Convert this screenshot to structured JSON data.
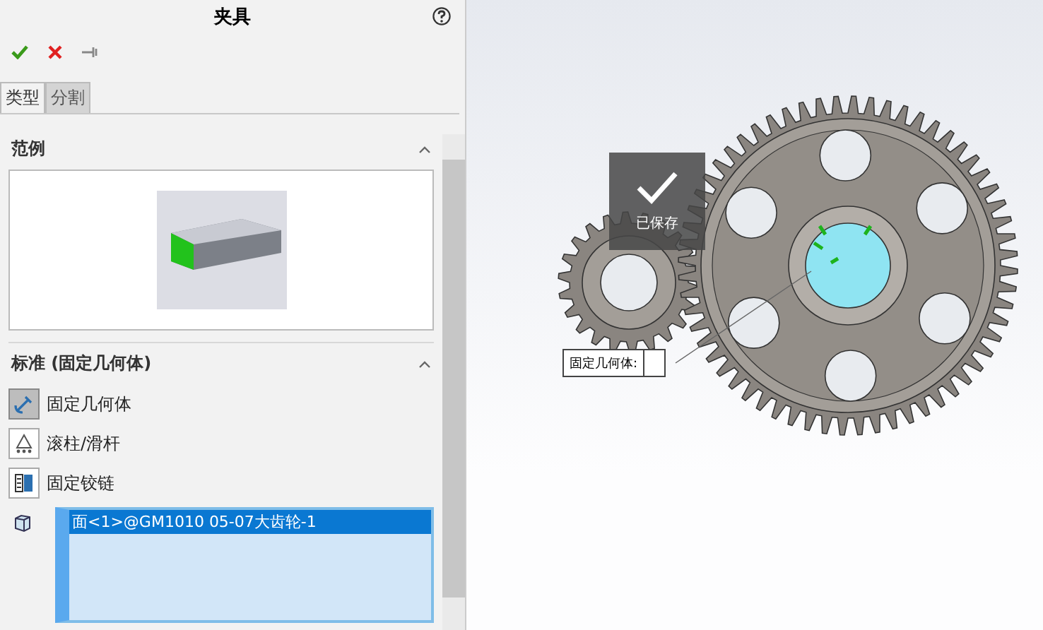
{
  "panel": {
    "title": "夹具",
    "tabs": [
      {
        "label": "类型",
        "selected": true
      },
      {
        "label": "分割",
        "selected": false
      }
    ],
    "example_section": {
      "title": "范例"
    },
    "standard_section": {
      "title": "标准 (固定几何体)",
      "types": [
        {
          "kind": "fixed",
          "label": "固定几何体",
          "selected": true
        },
        {
          "kind": "roller",
          "label": "滚柱/滑杆",
          "selected": false
        },
        {
          "kind": "hinge",
          "label": "固定铰链",
          "selected": false
        }
      ],
      "selection": [
        {
          "text": "面<1>@GM1010 05-07大齿轮-1",
          "selected": true
        }
      ]
    }
  },
  "viewport": {
    "toast": "已保存",
    "callout": "固定几何体:"
  }
}
